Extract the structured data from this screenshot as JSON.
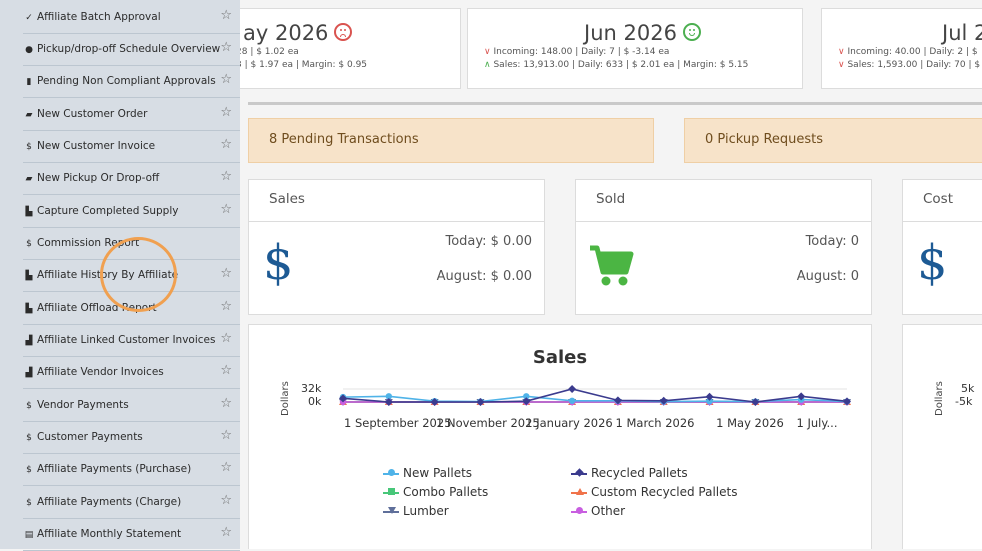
{
  "sidebar": {
    "items": [
      {
        "icon": "check-icon",
        "label": "Affiliate Batch Approval"
      },
      {
        "icon": "clock-icon",
        "label": "Pickup/drop-off Schedule Overview"
      },
      {
        "icon": "clipboard-icon",
        "label": "Pending Non Compliant Approvals"
      },
      {
        "icon": "truck-icon",
        "label": "New Customer Order"
      },
      {
        "icon": "dollar-icon",
        "label": "New Customer Invoice"
      },
      {
        "icon": "truck-icon",
        "label": "New Pickup Or Drop-off"
      },
      {
        "icon": "capture-icon",
        "label": "Capture Completed Supply"
      },
      {
        "icon": "dollar-icon",
        "label": "Commission Report"
      },
      {
        "icon": "bar-chart-icon",
        "label": "Affiliate History By Affiliate"
      },
      {
        "icon": "bar-chart-icon",
        "label": "Affiliate Offload Report"
      },
      {
        "icon": "hand-icon",
        "label": "Affiliate Linked Customer Invoices"
      },
      {
        "icon": "hand-icon",
        "label": "Affiliate Vendor Invoices"
      },
      {
        "icon": "dollar-icon",
        "label": "Vendor Payments"
      },
      {
        "icon": "dollar-icon",
        "label": "Customer Payments"
      },
      {
        "icon": "dollar-icon",
        "label": "Affiliate Payments (Purchase)"
      },
      {
        "icon": "dollar-icon",
        "label": "Affiliate Payments (Charge)"
      },
      {
        "icon": "list-icon",
        "label": "Affiliate Monthly Statement"
      }
    ]
  },
  "months": [
    {
      "title": "ay 2026",
      "mood": "sad",
      "line1": "28 | $ 1.02 ea",
      "line2": "3 | $ 1.97 ea | Margin: $ 0.95"
    },
    {
      "title": "Jun 2026",
      "mood": "happy",
      "line1": "Incoming: 148.00 | Daily: 7 | $ -3.14 ea",
      "line2": "Sales: 13,913.00 | Daily: 633 | $ 2.01 ea | Margin: $ 5.15"
    },
    {
      "title": "Jul 2",
      "line1": "Incoming: 40.00 | Daily: 2 | $",
      "line2": "Sales: 1,593.00 | Daily: 70 | $"
    }
  ],
  "pending": {
    "transactions": "8 Pending Transactions",
    "pickups": "0 Pickup Requests"
  },
  "stats": {
    "sales": {
      "title": "Sales",
      "today": "Today: $ 0.00",
      "month": "August: $ 0.00"
    },
    "sold": {
      "title": "Sold",
      "today": "Today: 0",
      "month": "August: 0"
    },
    "cost": {
      "title": "Cost"
    }
  },
  "colors": {
    "accent_blue": "#1d5a94",
    "cart_green": "#4bb543",
    "pending_bg": "#f7e3c9",
    "sad": "#d9534f",
    "happy": "#4caf50",
    "highlight": "#f0a050"
  },
  "chart_data": [
    {
      "type": "line",
      "title": "Sales",
      "ylabel": "Dollars",
      "y_ticks": [
        "32k",
        "0k"
      ],
      "x_tick_labels": [
        "1 September 2025",
        "1 November 2025",
        "1 January 2026",
        "1 March 2026",
        "1 May 2026",
        "1 July..."
      ],
      "x": [
        "Aug 2025",
        "Sep 2025",
        "Oct 2025",
        "Nov 2025",
        "Dec 2025",
        "Jan 2026",
        "Feb 2026",
        "Mar 2026",
        "Apr 2026",
        "May 2026",
        "Jun 2026",
        "Jul 2026"
      ],
      "ylim": [
        0,
        32000
      ],
      "legend_position": "bottom",
      "series": [
        {
          "name": "New Pallets",
          "color": "#4fb3e8",
          "marker": "circle",
          "values": [
            12000,
            14000,
            2000,
            1000,
            14000,
            3000,
            3000,
            1000,
            2000,
            1000,
            6000,
            1000
          ]
        },
        {
          "name": "Recycled Pallets",
          "color": "#3b3b8e",
          "marker": "diamond",
          "values": [
            9000,
            0,
            0,
            0,
            2000,
            32000,
            4000,
            3000,
            13000,
            0,
            13913,
            1593
          ]
        },
        {
          "name": "Combo Pallets",
          "color": "#47c779",
          "marker": "square",
          "values": [
            0,
            0,
            0,
            0,
            0,
            0,
            0,
            0,
            0,
            0,
            0,
            0
          ]
        },
        {
          "name": "Custom Recycled Pallets",
          "color": "#f0734a",
          "marker": "triangle",
          "values": [
            0,
            0,
            0,
            0,
            0,
            0,
            0,
            0,
            0,
            0,
            0,
            0
          ]
        },
        {
          "name": "Lumber",
          "color": "#5f6f9a",
          "marker": "triangle-down",
          "values": [
            0,
            0,
            0,
            0,
            0,
            0,
            0,
            0,
            0,
            0,
            0,
            0
          ]
        },
        {
          "name": "Other",
          "color": "#c85ee0",
          "marker": "circle",
          "values": [
            0,
            0,
            0,
            0,
            0,
            0,
            0,
            0,
            0,
            0,
            0,
            0
          ]
        }
      ]
    },
    {
      "type": "line",
      "title": "",
      "ylabel": "Dollars",
      "y_ticks": [
        "5k",
        "-5k"
      ]
    }
  ]
}
